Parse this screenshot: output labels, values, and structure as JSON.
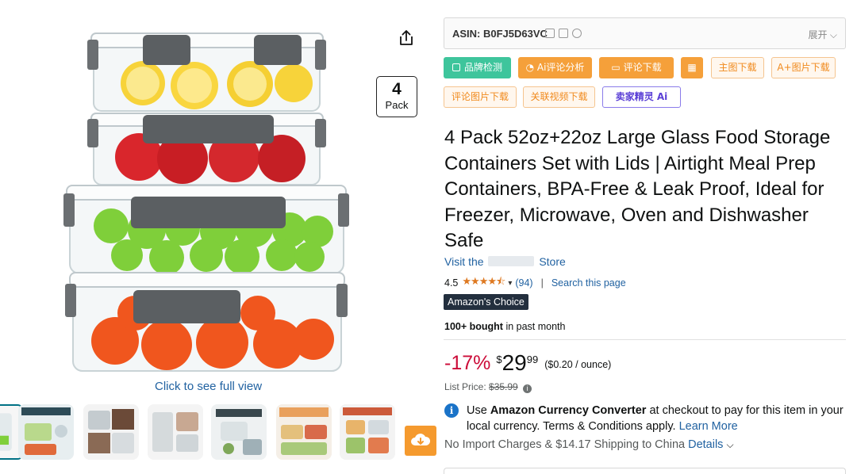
{
  "gallery": {
    "pack_badge": {
      "number": "4",
      "label": "Pack"
    },
    "full_view_link": "Click to see full view",
    "thumbnails": [
      {
        "name": "thumb-1",
        "active": true
      },
      {
        "name": "thumb-2",
        "active": false
      },
      {
        "name": "thumb-3",
        "active": false
      },
      {
        "name": "thumb-4",
        "active": false
      },
      {
        "name": "thumb-5",
        "active": false
      },
      {
        "name": "thumb-6",
        "active": false
      },
      {
        "name": "thumb-7",
        "active": false
      }
    ]
  },
  "plugin": {
    "asin_label": "ASIN: B0FJ5D63VC",
    "expand_label": "展开",
    "buttons": {
      "brand_check": "品牌检测",
      "ai_review": "Ai评论分析",
      "review_download": "评论下载",
      "main_image_download": "主图下载",
      "aplus_download": "A+图片下载",
      "review_image_download": "评论图片下载",
      "related_video_download": "关联视频下载",
      "seller_ai": "卖家精灵 Ai"
    }
  },
  "product": {
    "title": "4 Pack 52oz+22oz Large Glass Food Storage Containers Set with Lids | Airtight Meal Prep Containers, BPA-Free & Leak Proof, Ideal for Freezer, Microwave, Oven and Dishwasher Safe",
    "store_prefix": "Visit the",
    "store_suffix": "Store",
    "rating_value": "4.5",
    "rating_stars": "★★★★⯪",
    "rating_count": "(94)",
    "rating_separator": "|",
    "search_page": "Search this page",
    "choice_badge": "Amazon's Choice",
    "bought_bold": "100+ bought",
    "bought_rest": " in past month",
    "discount": "-17%",
    "price_symbol": "$",
    "price_whole": "29",
    "price_fraction": "99",
    "unit_price": "($0.20 / ounce)",
    "list_price_label": "List Price:",
    "list_price": "$35.99",
    "currency_note": {
      "pre": "Use ",
      "bold": "Amazon Currency Converter",
      "post": " at checkout to pay for this item in your local currency. Terms & Conditions apply. ",
      "link": "Learn More"
    },
    "shipping_text": "No Import Charges & $14.17 Shipping to China ",
    "shipping_link": "Details"
  },
  "colors": {
    "link": "#2162a1",
    "discount": "#cc0c39",
    "star": "#de7921",
    "green_btn": "#3ec59c",
    "orange_btn": "#f5a03a",
    "badge_dark": "#232f3e"
  }
}
